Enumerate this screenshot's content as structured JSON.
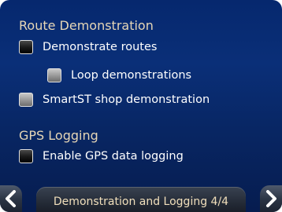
{
  "route_demonstration": {
    "heading": "Route Demonstration",
    "items": [
      {
        "label": "Demonstrate routes",
        "checked": false
      },
      {
        "label": "Loop demonstrations",
        "checked": false,
        "disabled": true
      },
      {
        "label": "SmartST shop demonstration",
        "checked": false
      }
    ]
  },
  "gps_logging": {
    "heading": "GPS Logging",
    "items": [
      {
        "label": "Enable GPS data logging",
        "checked": false
      }
    ]
  },
  "footer": {
    "title": "Demonstration and Logging 4/4",
    "prev_icon": "chevron-left-icon",
    "next_icon": "chevron-right-icon"
  },
  "colors": {
    "background": "#0a2f78",
    "heading": "#e6d6b6",
    "label": "#ffffff",
    "footer_title": "#f1dfbb"
  }
}
